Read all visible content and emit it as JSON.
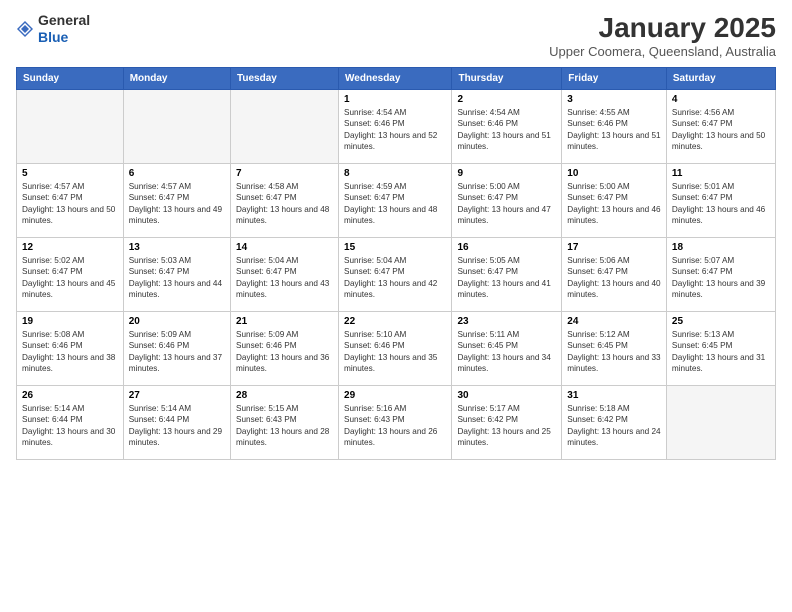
{
  "logo": {
    "general": "General",
    "blue": "Blue"
  },
  "title": "January 2025",
  "subtitle": "Upper Coomera, Queensland, Australia",
  "headers": [
    "Sunday",
    "Monday",
    "Tuesday",
    "Wednesday",
    "Thursday",
    "Friday",
    "Saturday"
  ],
  "weeks": [
    [
      {
        "day": "",
        "empty": true
      },
      {
        "day": "",
        "empty": true
      },
      {
        "day": "",
        "empty": true
      },
      {
        "day": "1",
        "sunrise": "4:54 AM",
        "sunset": "6:46 PM",
        "daylight": "13 hours and 52 minutes."
      },
      {
        "day": "2",
        "sunrise": "4:54 AM",
        "sunset": "6:46 PM",
        "daylight": "13 hours and 51 minutes."
      },
      {
        "day": "3",
        "sunrise": "4:55 AM",
        "sunset": "6:46 PM",
        "daylight": "13 hours and 51 minutes."
      },
      {
        "day": "4",
        "sunrise": "4:56 AM",
        "sunset": "6:47 PM",
        "daylight": "13 hours and 50 minutes."
      }
    ],
    [
      {
        "day": "5",
        "sunrise": "4:57 AM",
        "sunset": "6:47 PM",
        "daylight": "13 hours and 50 minutes."
      },
      {
        "day": "6",
        "sunrise": "4:57 AM",
        "sunset": "6:47 PM",
        "daylight": "13 hours and 49 minutes."
      },
      {
        "day": "7",
        "sunrise": "4:58 AM",
        "sunset": "6:47 PM",
        "daylight": "13 hours and 48 minutes."
      },
      {
        "day": "8",
        "sunrise": "4:59 AM",
        "sunset": "6:47 PM",
        "daylight": "13 hours and 48 minutes."
      },
      {
        "day": "9",
        "sunrise": "5:00 AM",
        "sunset": "6:47 PM",
        "daylight": "13 hours and 47 minutes."
      },
      {
        "day": "10",
        "sunrise": "5:00 AM",
        "sunset": "6:47 PM",
        "daylight": "13 hours and 46 minutes."
      },
      {
        "day": "11",
        "sunrise": "5:01 AM",
        "sunset": "6:47 PM",
        "daylight": "13 hours and 46 minutes."
      }
    ],
    [
      {
        "day": "12",
        "sunrise": "5:02 AM",
        "sunset": "6:47 PM",
        "daylight": "13 hours and 45 minutes."
      },
      {
        "day": "13",
        "sunrise": "5:03 AM",
        "sunset": "6:47 PM",
        "daylight": "13 hours and 44 minutes."
      },
      {
        "day": "14",
        "sunrise": "5:04 AM",
        "sunset": "6:47 PM",
        "daylight": "13 hours and 43 minutes."
      },
      {
        "day": "15",
        "sunrise": "5:04 AM",
        "sunset": "6:47 PM",
        "daylight": "13 hours and 42 minutes."
      },
      {
        "day": "16",
        "sunrise": "5:05 AM",
        "sunset": "6:47 PM",
        "daylight": "13 hours and 41 minutes."
      },
      {
        "day": "17",
        "sunrise": "5:06 AM",
        "sunset": "6:47 PM",
        "daylight": "13 hours and 40 minutes."
      },
      {
        "day": "18",
        "sunrise": "5:07 AM",
        "sunset": "6:47 PM",
        "daylight": "13 hours and 39 minutes."
      }
    ],
    [
      {
        "day": "19",
        "sunrise": "5:08 AM",
        "sunset": "6:46 PM",
        "daylight": "13 hours and 38 minutes."
      },
      {
        "day": "20",
        "sunrise": "5:09 AM",
        "sunset": "6:46 PM",
        "daylight": "13 hours and 37 minutes."
      },
      {
        "day": "21",
        "sunrise": "5:09 AM",
        "sunset": "6:46 PM",
        "daylight": "13 hours and 36 minutes."
      },
      {
        "day": "22",
        "sunrise": "5:10 AM",
        "sunset": "6:46 PM",
        "daylight": "13 hours and 35 minutes."
      },
      {
        "day": "23",
        "sunrise": "5:11 AM",
        "sunset": "6:45 PM",
        "daylight": "13 hours and 34 minutes."
      },
      {
        "day": "24",
        "sunrise": "5:12 AM",
        "sunset": "6:45 PM",
        "daylight": "13 hours and 33 minutes."
      },
      {
        "day": "25",
        "sunrise": "5:13 AM",
        "sunset": "6:45 PM",
        "daylight": "13 hours and 31 minutes."
      }
    ],
    [
      {
        "day": "26",
        "sunrise": "5:14 AM",
        "sunset": "6:44 PM",
        "daylight": "13 hours and 30 minutes."
      },
      {
        "day": "27",
        "sunrise": "5:14 AM",
        "sunset": "6:44 PM",
        "daylight": "13 hours and 29 minutes."
      },
      {
        "day": "28",
        "sunrise": "5:15 AM",
        "sunset": "6:43 PM",
        "daylight": "13 hours and 28 minutes."
      },
      {
        "day": "29",
        "sunrise": "5:16 AM",
        "sunset": "6:43 PM",
        "daylight": "13 hours and 26 minutes."
      },
      {
        "day": "30",
        "sunrise": "5:17 AM",
        "sunset": "6:42 PM",
        "daylight": "13 hours and 25 minutes."
      },
      {
        "day": "31",
        "sunrise": "5:18 AM",
        "sunset": "6:42 PM",
        "daylight": "13 hours and 24 minutes."
      },
      {
        "day": "",
        "empty": true
      }
    ]
  ]
}
